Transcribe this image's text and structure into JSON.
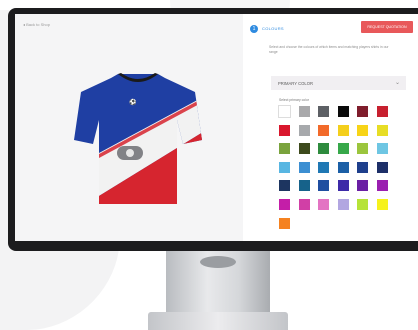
{
  "preview": {
    "back_link": "◂ Back to Shop"
  },
  "panel": {
    "step_number": "1",
    "step_label": "COLOURS",
    "cta": "REQUEST QUOTATION",
    "description": "Select and choose the colours of which items and matching players shirts in our range",
    "section_label": "PRIMARY COLOR",
    "select_label": "Select primary color"
  },
  "jersey_colors": {
    "blue": "#1f3fa3",
    "red": "#d6252f",
    "white": "#f2f2f2",
    "collar": "#1a1a1a"
  },
  "swatches": [
    [
      "#ffffff",
      "#a9a9ab",
      "#5d6065",
      "#0a0a0a",
      "#7f1d2c",
      "#c7202f"
    ],
    [
      "#d9172d",
      "#a7a9ac",
      "#f26a2a",
      "#f4cf1c",
      "#f7d417",
      "#e7dd25"
    ],
    [
      "#7aa33d",
      "#3d4a1c",
      "#2e8b3d",
      "#37a84a",
      "#9bc53d",
      "#6ec6e3"
    ],
    [
      "#58b6e2",
      "#3c8fd2",
      "#1f78b4",
      "#1b5fa6",
      "#1e3f8c",
      "#1d2f68"
    ],
    [
      "#1d3560",
      "#16628a",
      "#1f4ea0",
      "#3d2aa8",
      "#6a1fa4",
      "#9a1fb0"
    ],
    [
      "#c41ea8",
      "#d13fa6",
      "#e374c3",
      "#b2a6e1",
      "#b6e338",
      "#f6f21c"
    ],
    [
      "#f58220"
    ]
  ]
}
